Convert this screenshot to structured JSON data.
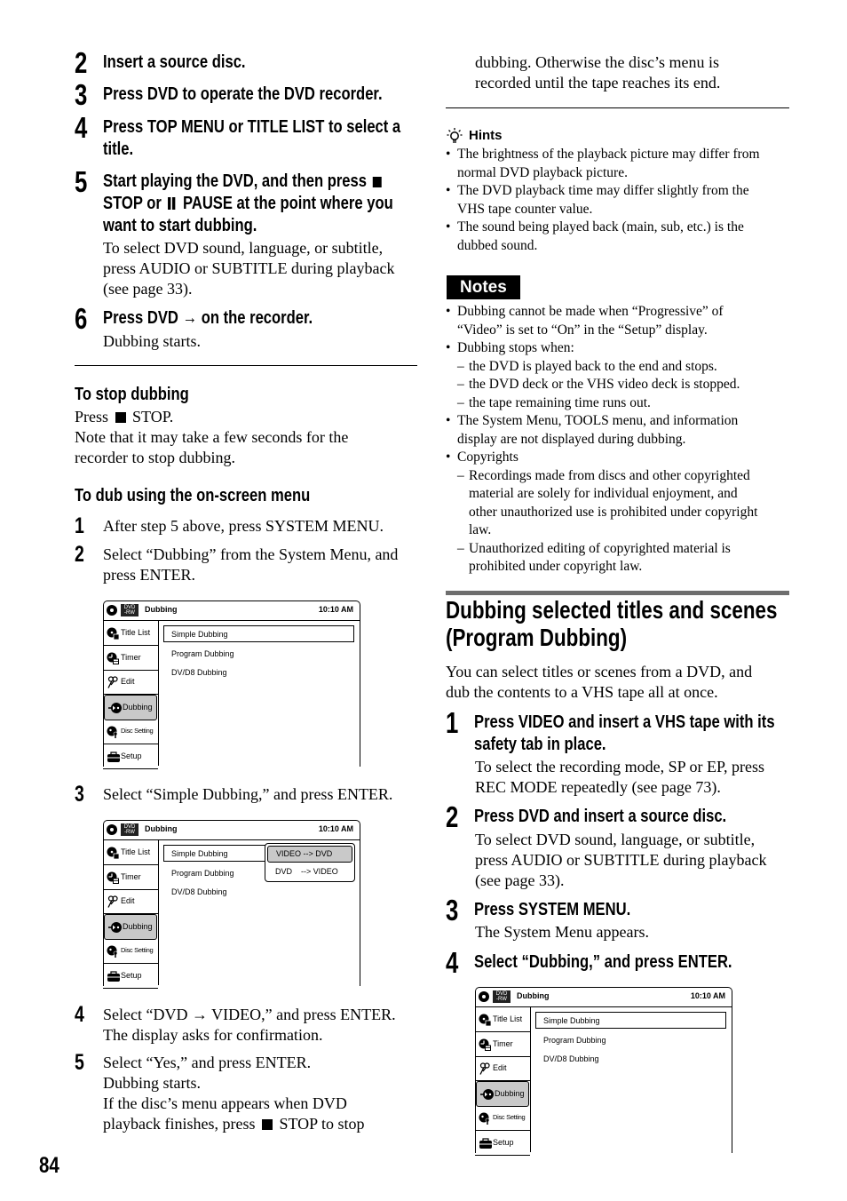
{
  "page": {
    "number": "84"
  },
  "left_column": {
    "steps": [
      {
        "num": "2",
        "heading": "Insert a source disc."
      },
      {
        "num": "3",
        "heading": "Press DVD to operate the DVD recorder."
      },
      {
        "num": "4",
        "heading_lines": [
          "Press TOP MENU or TITLE LIST to select a",
          "title."
        ]
      },
      {
        "num": "5",
        "heading_line1_pre": "Start playing the DVD, and then press",
        "heading_line2_pre": "STOP or",
        "heading_line2_post": "PAUSE at the point where you",
        "heading_line3": "want to start dubbing.",
        "body": [
          "To select DVD sound, language, or subtitle,",
          "press AUDIO or SUBTITLE during playback",
          "(see page 33)."
        ]
      },
      {
        "num": "6",
        "heading": "Press DVD → on the recorder.",
        "body": [
          "Dubbing starts."
        ]
      }
    ],
    "stop_section": {
      "title": "To stop dubbing",
      "line1_pre": "Press",
      "line1_post": "STOP.",
      "lines": [
        "Note that it may take a few seconds for the",
        "recorder to stop dubbing."
      ]
    },
    "onscreen_section": {
      "title": "To dub using the on-screen menu",
      "steps": [
        {
          "num": "1",
          "text": [
            "After step 5 above, press SYSTEM MENU."
          ]
        },
        {
          "num": "2",
          "text": [
            "Select “Dubbing” from the System Menu, and",
            "press ENTER."
          ]
        },
        {
          "num": "3",
          "text": [
            "Select “Simple Dubbing,” and press ENTER."
          ]
        },
        {
          "num": "4",
          "text": [
            "Select “DVD → VIDEO,” and press ENTER.",
            "The display asks for confirmation."
          ]
        },
        {
          "num": "5",
          "text": [
            "Select “Yes,” and press ENTER.",
            "Dubbing starts.",
            "If the disc’s menu appears when DVD"
          ],
          "last_pre": "playback finishes, press",
          "last_post": "STOP to stop"
        }
      ]
    }
  },
  "osd": {
    "disc_badge": [
      "DVD",
      "-RW"
    ],
    "title": "Dubbing",
    "clock": "10:10 AM",
    "side_items": [
      {
        "label": "Title List",
        "icon": "title-list-icon"
      },
      {
        "label": "Timer",
        "icon": "timer-icon"
      },
      {
        "label": "Edit",
        "icon": "edit-scissors-icon"
      },
      {
        "label": "Dubbing",
        "icon": "dubbing-icon",
        "selected": true
      },
      {
        "label": "Disc Setting",
        "icon": "disc-setting-icon"
      },
      {
        "label": "Setup",
        "icon": "setup-toolbox-icon"
      }
    ],
    "options": [
      "Simple Dubbing",
      "Program Dubbing",
      "DV/D8 Dubbing"
    ],
    "popup": [
      "VIDEO --> DVD",
      "DVD    --> VIDEO"
    ]
  },
  "right_column": {
    "continuation": [
      "dubbing. Otherwise the disc’s menu is",
      "recorded until the tape reaches its end."
    ],
    "hints": {
      "title": "Hints",
      "items": [
        [
          "The brightness of the playback picture may differ from",
          "normal DVD playback picture."
        ],
        [
          "The DVD playback time may differ slightly from the",
          "VHS tape counter value."
        ],
        [
          "The sound being played back (main, sub, etc.) is the",
          "dubbed sound."
        ]
      ]
    },
    "notes": {
      "title": "Notes",
      "item1": [
        "Dubbing cannot be made when “Progressive” of",
        "“Video” is set to “On” in the “Setup” display."
      ],
      "item2": "Dubbing stops when:",
      "item2_subs": [
        "the DVD is played back to the end and stops.",
        "the DVD deck or the VHS video deck is stopped.",
        "the tape remaining time runs out."
      ],
      "item3": [
        "The System Menu, TOOLS menu, and information",
        "display are not displayed during dubbing."
      ],
      "item4": "Copyrights",
      "item4_sub1": [
        "Recordings made from discs and other copyrighted",
        "material are solely for individual enjoyment, and",
        "other unauthorized use is prohibited under copyright",
        "law."
      ],
      "item4_sub2": [
        "Unauthorized editing of copyrighted material is",
        "prohibited under copyright law."
      ],
      "dash": "–"
    },
    "section": {
      "title": [
        "Dubbing selected titles and scenes",
        "(Program Dubbing)"
      ],
      "intro": [
        "You can select titles or scenes from a DVD, and",
        "dub the contents to a VHS tape all at once."
      ],
      "steps": [
        {
          "num": "1",
          "heading": [
            "Press VIDEO and insert a VHS tape with its",
            "safety tab in place."
          ],
          "body": [
            "To select the recording mode, SP or EP, press",
            "REC MODE repeatedly (see page 73)."
          ]
        },
        {
          "num": "2",
          "heading": [
            "Press DVD and insert a source disc."
          ],
          "body": [
            "To select DVD sound, language, or subtitle,",
            "press AUDIO or SUBTITLE during playback",
            "(see page 33)."
          ]
        },
        {
          "num": "3",
          "heading": [
            "Press SYSTEM MENU."
          ],
          "body": [
            "The System Menu appears."
          ]
        },
        {
          "num": "4",
          "heading": [
            "Select “Dubbing,” and press ENTER."
          ]
        }
      ]
    }
  }
}
